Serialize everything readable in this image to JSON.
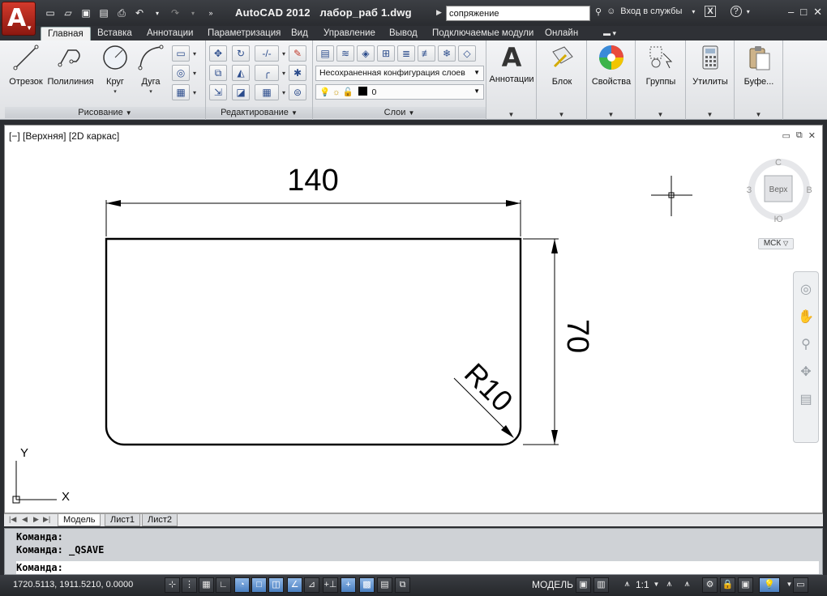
{
  "title": {
    "app": "AutoCAD 2012",
    "file": "лабор_раб 1.dwg"
  },
  "search": {
    "value": "сопряжение"
  },
  "titlebar": {
    "login": "Вход в службы"
  },
  "tabs": [
    {
      "label": "Главная"
    },
    {
      "label": "Вставка"
    },
    {
      "label": "Аннотации"
    },
    {
      "label": "Параметризация"
    },
    {
      "label": "Вид"
    },
    {
      "label": "Управление"
    },
    {
      "label": "Вывод"
    },
    {
      "label": "Подключаемые модули"
    },
    {
      "label": "Онлайн"
    }
  ],
  "ribbon": {
    "draw": {
      "title": "Рисование",
      "line": "Отрезок",
      "polyline": "Полилиния",
      "circle": "Круг",
      "arc": "Дуга"
    },
    "modify": {
      "title": "Редактирование"
    },
    "layers": {
      "title": "Слои",
      "state": "Несохраненная конфигурация слоев",
      "current": "0"
    },
    "annotation": "Аннотации",
    "block": "Блок",
    "properties": "Свойства",
    "groups": "Группы",
    "utilities": "Утилиты",
    "clipboard": "Буфе..."
  },
  "viewport": {
    "label": "[−] [Верхняя] [2D каркас]",
    "dim_width": "140",
    "dim_height": "70",
    "dim_radius": "R10",
    "viewcube": {
      "n": "С",
      "s": "Ю",
      "w": "З",
      "e": "В",
      "face": "Верх"
    },
    "ucs": "МСК",
    "axis_x": "X",
    "axis_y": "Y"
  },
  "layout_tabs": [
    {
      "label": "Модель"
    },
    {
      "label": "Лист1"
    },
    {
      "label": "Лист2"
    }
  ],
  "command": {
    "line1": "Команда:",
    "line2": "Команда: _QSAVE",
    "prompt": "Команда:"
  },
  "status": {
    "coords": "1720.5113, 1911.5210, 0.0000",
    "model": "МОДЕЛЬ",
    "scale": "1:1"
  }
}
